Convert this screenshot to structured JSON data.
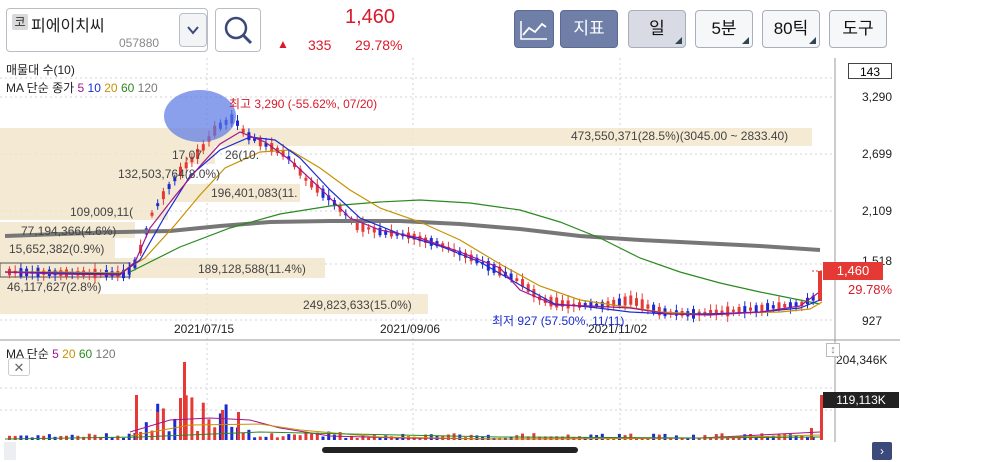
{
  "stock": {
    "market_badge": "코",
    "name": "피에이치씨",
    "code": "057880",
    "price": "1,460",
    "change_arrow": "▲",
    "change": "335",
    "change_rate": "29.78%"
  },
  "toolbar": {
    "indicator_label": "지표",
    "period_label": "일",
    "minute_label": "5분",
    "tick_label": "80틱",
    "tools_label": "도구"
  },
  "legend": {
    "volume_profile": "매물대 수(10)",
    "ma_price_prefix": "MA 단순 종가",
    "ma_volume_prefix": "MA 단순",
    "ma_price_periods": [
      "5",
      "10",
      "20",
      "60",
      "120"
    ],
    "ma_volume_periods": [
      "5",
      "20",
      "60",
      "120"
    ]
  },
  "colors": {
    "ma5": "#a0168e",
    "ma10": "#1b2bd0",
    "ma20": "#c79200",
    "ma60": "#2a8a1f",
    "ma120": "#777777",
    "up": "#e53935",
    "down": "#1b2bd0"
  },
  "price_axis": {
    "count": "143",
    "labels": [
      "3,290",
      "2,699",
      "2,109",
      "1,518",
      "927"
    ],
    "current": "1,460",
    "current_rate": "29.78%"
  },
  "volume_axis": {
    "max": "204,346K",
    "current": "119,113K"
  },
  "dates": [
    "2021/07/15",
    "2021/09/06",
    "2021/11/02"
  ],
  "annotations": {
    "high": "최고 3,290 (-55.62%, 07/20)",
    "low": "최저 927 (57.50%, 11/11)"
  },
  "volume_profile_labels": [
    "473,550,371(28.5%)(3045.00 ~ 2833.40)",
    "17,07",
    "26(10.",
    "132,503,764(8.0%)",
    "196,401,083(11.",
    "109,009,11(",
    "77,194,366(4.6%)",
    "15,652,382(0.9%)",
    "189,128,588(11.4%)",
    "46,117,627(2.8%)",
    "249,823,633(15.0%)"
  ],
  "icons": {
    "dropdown": "chevron-down-icon",
    "search": "search-icon",
    "chart_type": "line-chart-icon",
    "close": "close-icon",
    "resize": "resize-icon",
    "scroll_right": "chevron-right-icon"
  }
}
